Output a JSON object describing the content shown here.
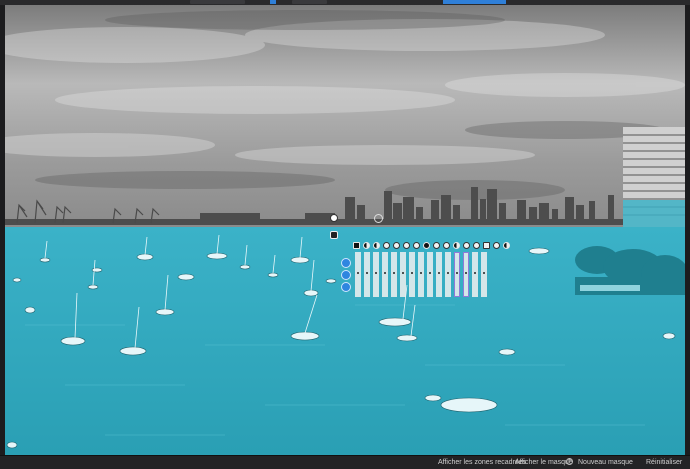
{
  "bottom_bar": {
    "show_cropped": "Afficher les zones recadrées",
    "show_mask": "Afficher le masque",
    "new_mask": "Nouveau masque",
    "reset": "Réinitialiser"
  },
  "colors": {
    "mask_overlay": "#2aa7bd",
    "accent": "#2f7fd8",
    "sky": "#bdbdbd",
    "city": "#4a4a4a"
  },
  "icons": {
    "new_mask": "plus-circle-icon",
    "tool_row": [
      "brush-icon",
      "contrast-icon",
      "halftone-icon",
      "circle-icon",
      "circle-icon",
      "circle-icon",
      "circle-icon",
      "dark-circle-icon",
      "eye-icon",
      "circle-icon",
      "halftone-icon",
      "drop-icon",
      "drop-icon",
      "image-icon",
      "circle-icon",
      "halftone-icon"
    ]
  }
}
